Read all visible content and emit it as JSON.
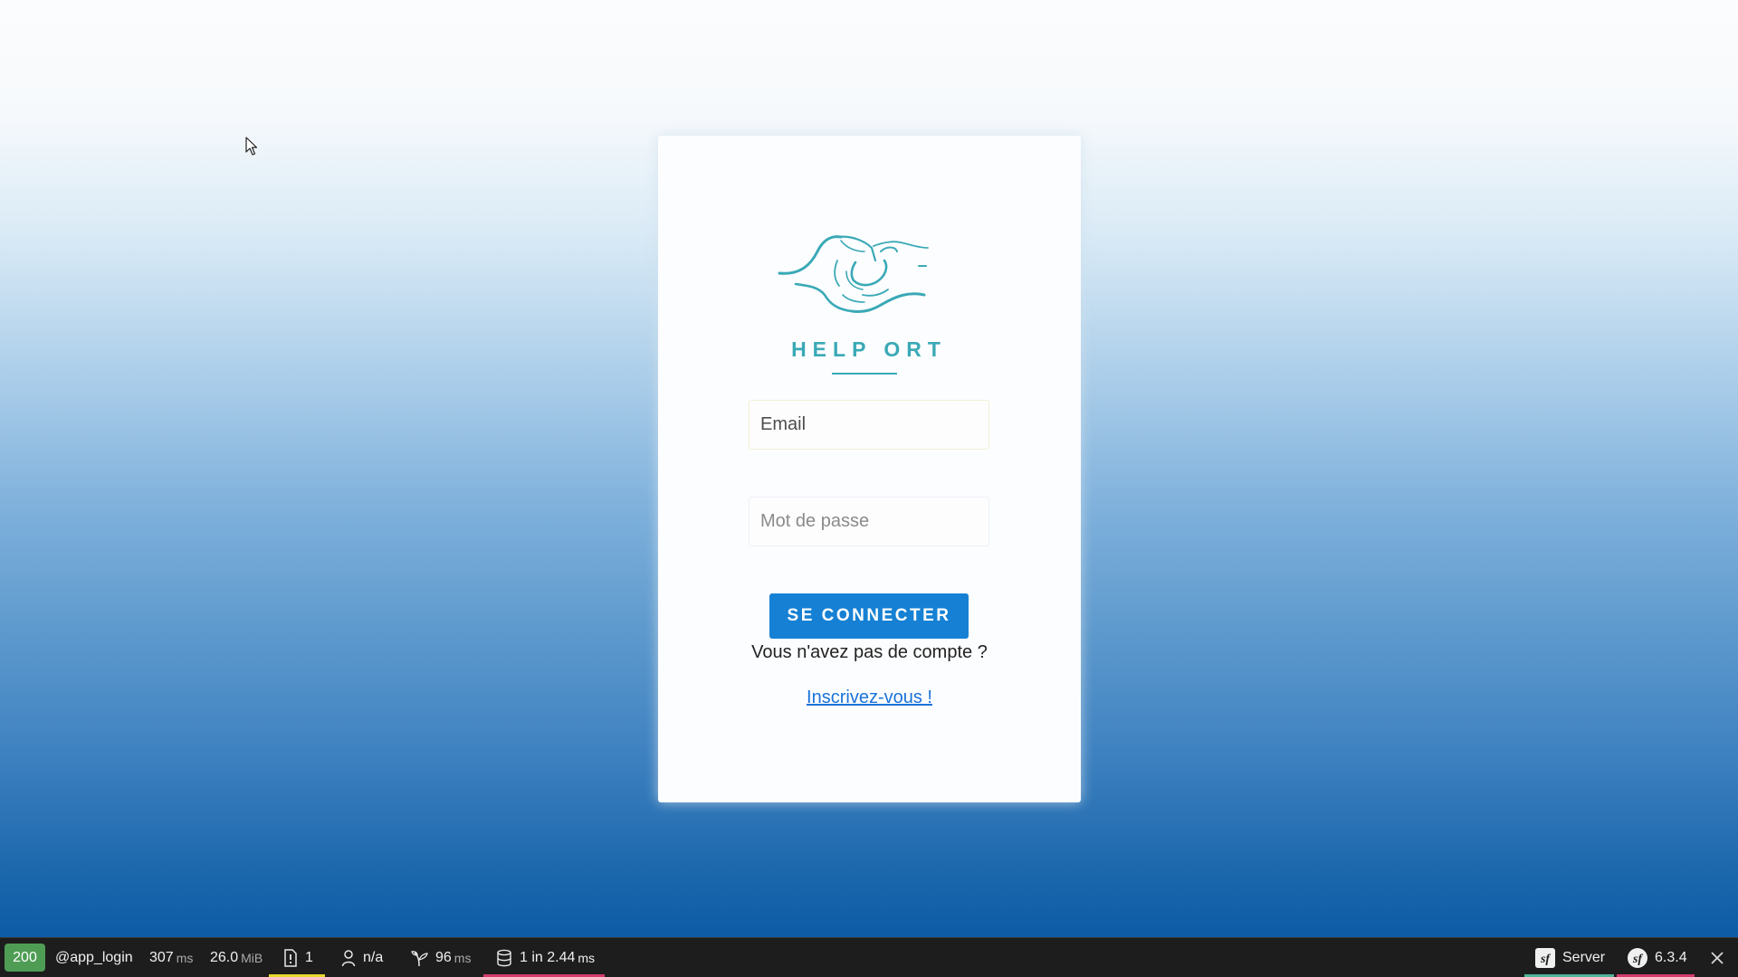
{
  "login": {
    "logo_text": "HELP ORT",
    "email_placeholder": "Email",
    "password_placeholder": "Mot de passe",
    "submit_label": "SE CONNECTER",
    "no_account_text": "Vous n'avez pas de compte ?",
    "signup_link": "Inscrivez-vous !"
  },
  "toolbar": {
    "status_code": "200",
    "route": "@app_login",
    "time_value": "307",
    "time_unit": "ms",
    "memory_value": "26.0",
    "memory_unit": "MiB",
    "logs_count": "1",
    "user": "n/a",
    "twig_value": "96",
    "twig_unit": "ms",
    "db_value": "1 in 2.44",
    "db_unit": "ms",
    "server_label": "Server",
    "symfony_version": "6.3.4"
  },
  "colors": {
    "brand_teal": "#3aa9b6",
    "primary_button": "#1681d4",
    "link": "#1a73d9",
    "status_ok": "#4f9d55",
    "logs_accent": "#e5d82a",
    "db_accent": "#d23b6c",
    "server_accent": "#4fb59a",
    "version_accent": "#d23b6c"
  },
  "icons": {
    "cursor": "mouse-pointer-icon",
    "logs": "warning-file-icon",
    "user": "person-icon",
    "twig": "twig-branch-icon",
    "database": "database-icon",
    "symfony": "symfony-logo-icon",
    "close": "close-icon"
  }
}
